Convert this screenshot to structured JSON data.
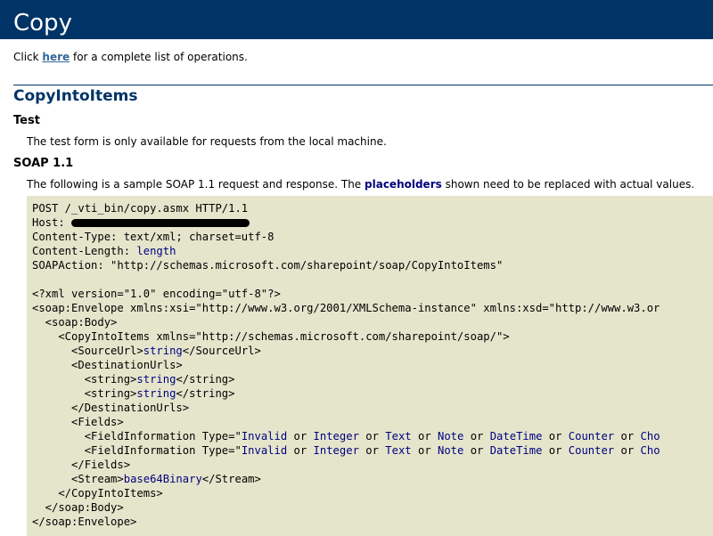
{
  "header": {
    "title": "Copy"
  },
  "intro": {
    "prefix": "Click ",
    "link": "here",
    "suffix": " for a complete list of operations."
  },
  "operation": {
    "title": "CopyIntoItems"
  },
  "test": {
    "heading": "Test",
    "text": "The test form is only available for requests from the local machine."
  },
  "soap": {
    "heading": "SOAP 1.1",
    "desc_prefix": "The following is a sample SOAP 1.1 request and response. The ",
    "desc_bold": "placeholders",
    "desc_suffix": " shown need to be replaced with actual values."
  },
  "code": {
    "line1": "POST /_vti_bin/copy.asmx HTTP/1.1",
    "line2": "Host: ",
    "line3": "Content-Type: text/xml; charset=utf-8",
    "line4_prefix": "Content-Length: ",
    "line4_ph": "length",
    "line5": "SOAPAction: \"http://schemas.microsoft.com/sharepoint/soap/CopyIntoItems\"",
    "line7": "<?xml version=\"1.0\" encoding=\"utf-8\"?>",
    "line8": "<soap:Envelope xmlns:xsi=\"http://www.w3.org/2001/XMLSchema-instance\" xmlns:xsd=\"http://www.w3.or",
    "line9": "  <soap:Body>",
    "line10": "    <CopyIntoItems xmlns=\"http://schemas.microsoft.com/sharepoint/soap/\">",
    "line11_open": "      <SourceUrl>",
    "line11_ph": "string",
    "line11_close": "</SourceUrl>",
    "line12": "      <DestinationUrls>",
    "line13_open": "        <string>",
    "line13_ph": "string",
    "line13_close": "</string>",
    "line14_open": "        <string>",
    "line14_ph": "string",
    "line14_close": "</string>",
    "line15": "      </DestinationUrls>",
    "line16": "      <Fields>",
    "fieldinfo_open": "        <FieldInformation Type=\"",
    "types": [
      "Invalid",
      "Integer",
      "Text",
      "Note",
      "DateTime",
      "Counter",
      "Cho"
    ],
    "or": " or ",
    "line19": "      </Fields>",
    "line20_open": "      <Stream>",
    "line20_ph": "base64Binary",
    "line20_close": "</Stream>",
    "line21": "    </CopyIntoItems>",
    "line22": "  </soap:Body>",
    "line23": "</soap:Envelope>"
  }
}
